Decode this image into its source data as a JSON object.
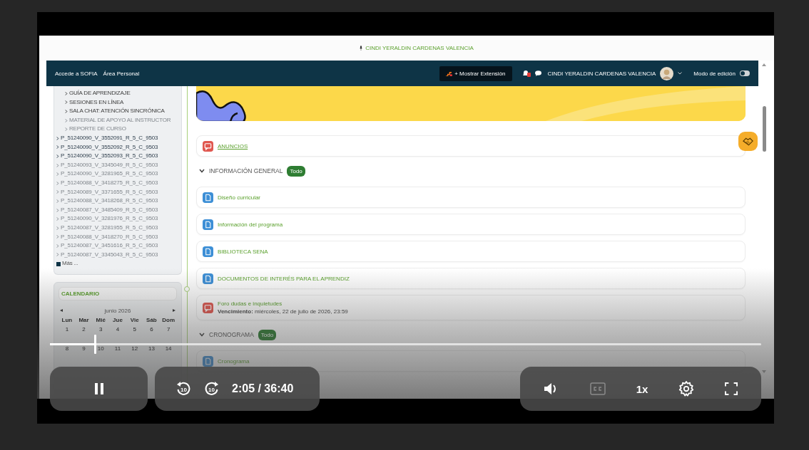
{
  "page": {
    "top_user": "CINDI YERALDIN CARDENAS VALENCIA",
    "nav": {
      "links": [
        "Accede a SOFIA",
        "Área Personal"
      ],
      "extension_button": "+ Mostrar Extensión",
      "user_name": "CINDI YERALDIN CARDENAS VALENCIA",
      "edit_mode": {
        "label": "Modo de edición",
        "on": false
      }
    },
    "course_nav": {
      "sub_items": [
        {
          "label": "GUÍA DE APRENDIZAJE",
          "faded": false
        },
        {
          "label": "SESIONES EN LÍNEA",
          "faded": false
        },
        {
          "label": "SALA CHAT: ATENCIÓN SINCRÓNICA",
          "faded": false
        },
        {
          "label": "MATERIAL DE APOYO AL INSTRUCTOR",
          "faded": true
        },
        {
          "label": "REPORTE DE CURSO",
          "faded": true
        }
      ],
      "items": [
        {
          "label": "P_51240090_V_3552091_R_5_C_9503",
          "faded": false
        },
        {
          "label": "P_51240090_V_3552092_R_5_C_9503",
          "faded": false
        },
        {
          "label": "P_51240090_V_3552093_R_5_C_9503",
          "faded": false
        },
        {
          "label": "P_51240093_V_3345049_R_5_C_9503",
          "faded": true
        },
        {
          "label": "P_51240090_V_3281965_R_5_C_9503",
          "faded": true
        },
        {
          "label": "P_51240088_V_3418275_R_5_C_9503",
          "faded": true
        },
        {
          "label": "P_51240089_V_3371655_R_5_C_9503",
          "faded": true
        },
        {
          "label": "P_51240088_V_3418268_R_5_C_9503",
          "faded": true
        },
        {
          "label": "P_51240087_V_3485409_R_5_C_9503",
          "faded": true
        },
        {
          "label": "P_51240090_V_3281976_R_5_C_9503",
          "faded": true
        },
        {
          "label": "P_51240087_V_3281955_R_5_C_9503",
          "faded": true
        },
        {
          "label": "P_51240088_V_3418270_R_5_C_9503",
          "faded": true
        },
        {
          "label": "P_51240087_V_3451616_R_5_C_9503",
          "faded": true
        },
        {
          "label": "P_51240087_V_3345043_R_5_C_9503",
          "faded": true
        }
      ],
      "more": "Más ..."
    },
    "calendar": {
      "title": "CALENDARIO",
      "month": "junio 2026",
      "weekdays": [
        "Lun",
        "Mar",
        "Mié",
        "Jue",
        "Vie",
        "Sáb",
        "Dom"
      ],
      "weeks": [
        [
          "1",
          "2",
          "3",
          "4",
          "5",
          "6",
          "7"
        ],
        [
          "8",
          "9",
          "10",
          "11",
          "12",
          "13",
          "14"
        ]
      ]
    },
    "course": {
      "announcement": {
        "kind": "forum",
        "label": "ANUNCIOS"
      },
      "sections": [
        {
          "title": "INFORMACIÓN GENERAL",
          "badge": "Todo",
          "expanded": true,
          "activities": [
            {
              "kind": "resource",
              "label": "Diseño curricular"
            },
            {
              "kind": "resource",
              "label": "Información del programa"
            },
            {
              "kind": "resource",
              "label": "BIBLIOTECA SENA"
            },
            {
              "kind": "resource",
              "label": "DOCUMENTOS DE INTERÉS PARA EL APRENDIZ"
            },
            {
              "kind": "forum",
              "label": "Foro dudas e inquietudes",
              "due": "**Vencimiento:** miércoles, 22 de julio de 2026, 23:59"
            }
          ]
        },
        {
          "title": "CRONOGRAMA",
          "badge": "Todo",
          "expanded": true,
          "activities": [
            {
              "kind": "resource",
              "label": "Cronograma"
            }
          ]
        }
      ]
    }
  },
  "player": {
    "playing": true,
    "level": 0.063,
    "skip_back": "10",
    "skip_forward": "10",
    "time": "2:05 / 36:40",
    "muted": false,
    "captions": false,
    "speed": "1x"
  }
}
